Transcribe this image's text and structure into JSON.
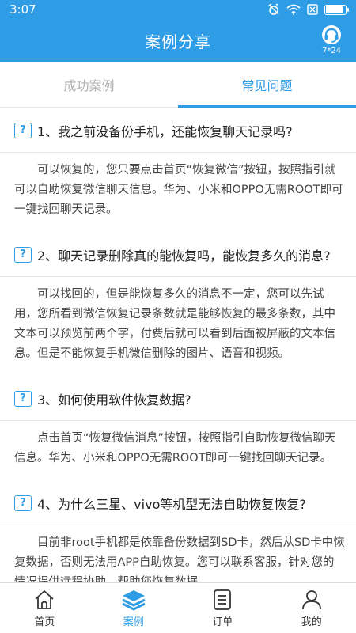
{
  "status_bar": {
    "time": "3:07"
  },
  "header": {
    "title": "案例分享",
    "service_label": "7*24"
  },
  "tabs": [
    {
      "label": "成功案例",
      "active": false
    },
    {
      "label": "常见问题",
      "active": true
    }
  ],
  "faq": [
    {
      "icon": "?",
      "question": "1、我之前没备份手机，还能恢复聊天记录吗?",
      "answer": "可以恢复的，您只要点击首页“恢复微信”按钮，按照指引就可以自助恢复微信聊天信息。华为、小米和OPPO无需ROOT即可一键找回聊天记录。"
    },
    {
      "icon": "?",
      "question": "2、聊天记录删除真的能恢复吗，能恢复多久的消息?",
      "answer": "可以找回的，但是能恢复多久的消息不一定，您可以先试用，您所看到微信恢复记录条数就是能够恢复的最多条数，其中文本可以预览前两个字，付费后就可以看到后面被屏蔽的文本信息。但是不能恢复手机微信删除的图片、语音和视频。"
    },
    {
      "icon": "?",
      "question": "3、如何使用软件恢复数据?",
      "answer": "点击首页“恢复微信消息”按钮，按照指引自助恢复微信聊天信息。华为、小米和OPPO无需ROOT即可一键找回聊天记录。"
    },
    {
      "icon": "?",
      "question": "4、为什么三星、vivo等机型无法自助恢复恢复?",
      "answer": "目前非root手机都是依靠备份数据到SD卡，然后从SD卡中恢复数据，否则无法用APP自助恢复。您可以联系客服，针对您的情况提供远程协助，帮助您恢复数据。"
    }
  ],
  "bottom_nav": [
    {
      "label": "首页",
      "icon": "home-icon"
    },
    {
      "label": "案例",
      "icon": "layers-icon",
      "active": true
    },
    {
      "label": "订单",
      "icon": "order-list-icon"
    },
    {
      "label": "我的",
      "icon": "user-icon"
    }
  ],
  "colors": {
    "primary": "#2f9de6",
    "text": "#222222",
    "muted": "#b0b0b0"
  }
}
